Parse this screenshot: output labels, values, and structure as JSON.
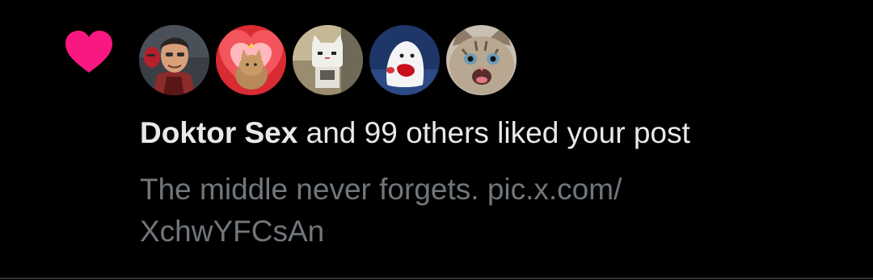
{
  "notification": {
    "type_icon": "heart-icon",
    "accent_color": "#f91880",
    "avatars": [
      {
        "icon": "avatar-medic-portrait"
      },
      {
        "icon": "avatar-cat-red-hearts"
      },
      {
        "icon": "avatar-toro-cat-figure"
      },
      {
        "icon": "avatar-white-ghost-blob"
      },
      {
        "icon": "avatar-kitten-face"
      }
    ],
    "actor_name": "Doktor Sex",
    "action_text": " and 99 others liked your post",
    "post_text": "The middle never forgets. pic.x.com/ XchwYFCsAn"
  }
}
